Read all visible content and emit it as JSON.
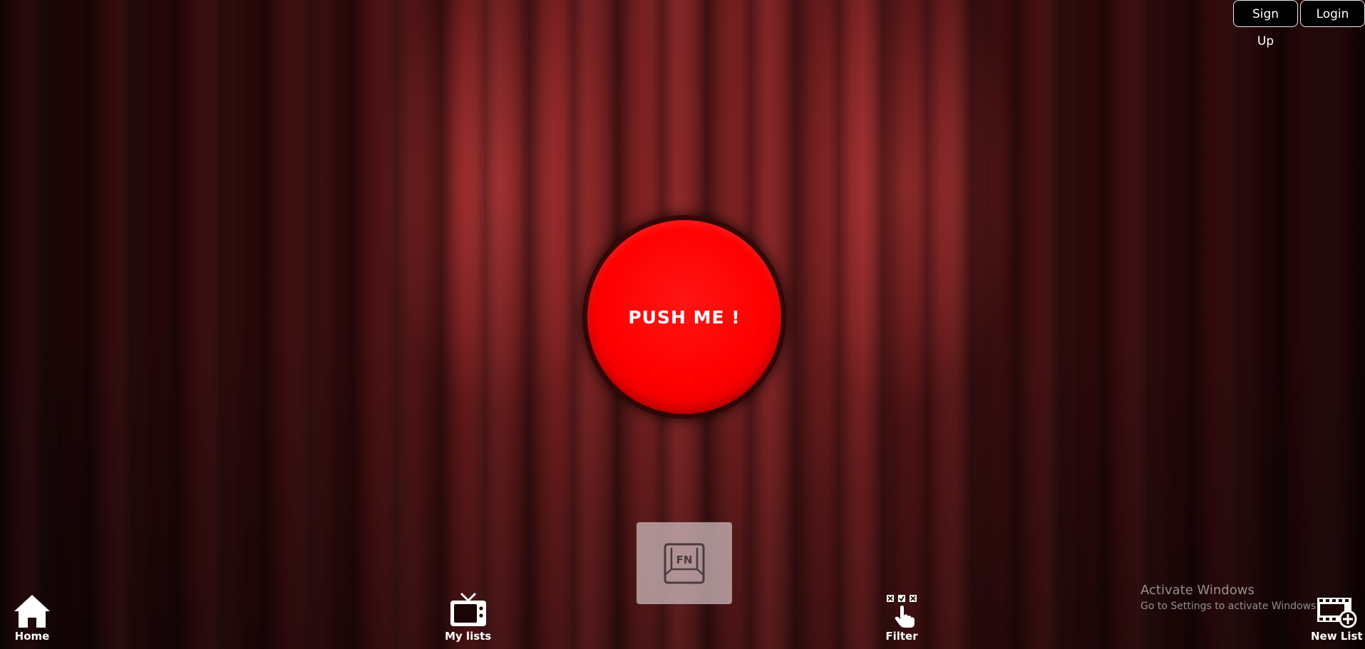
{
  "header": {
    "signup_label": "Sign Up",
    "login_label": "Login"
  },
  "main": {
    "push_button_label": "PUSH ME !",
    "fn_key_label": "FN"
  },
  "bottom_nav": {
    "home_label": "Home",
    "my_lists_label": "My lists",
    "filter_label": "Filter",
    "new_list_label": "New List"
  },
  "watermark": {
    "title": "Activate Windows",
    "subtitle": "Go to Settings to activate Windows."
  },
  "icons": {
    "home": "home-icon",
    "my_lists": "tv-icon",
    "filter": "filter-hand-icon",
    "new_list": "film-plus-icon",
    "fn": "fn-key-icon"
  },
  "colors": {
    "button_red": "#ff0000",
    "curtain": "#7b2223",
    "fn_key_bg": "#c8b4b6"
  }
}
